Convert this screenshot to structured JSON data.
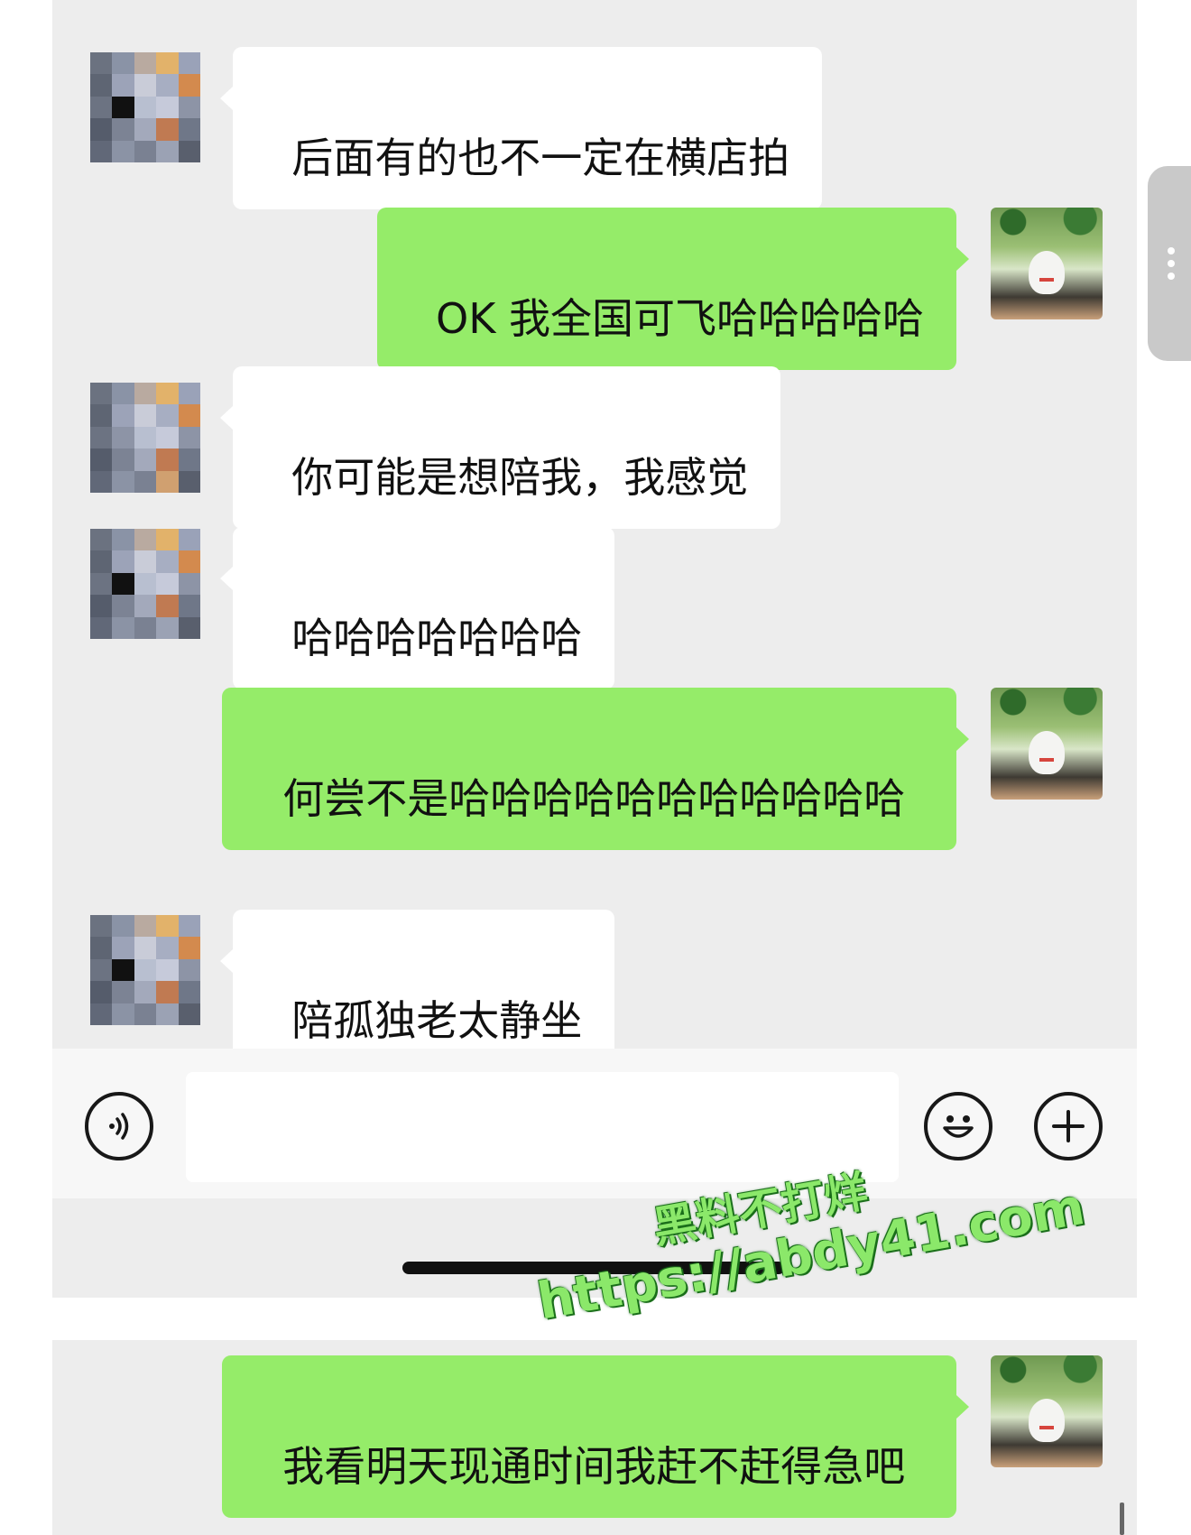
{
  "chat": {
    "messages": [
      {
        "side": "received",
        "text": "后面有的也不一定在横店拍"
      },
      {
        "side": "sent",
        "text": "OK 我全国可飞哈哈哈哈哈"
      },
      {
        "side": "received",
        "text": "你可能是想陪我，我感觉"
      },
      {
        "side": "received",
        "text": "哈哈哈哈哈哈哈"
      },
      {
        "side": "sent",
        "text": "何尝不是哈哈哈哈哈哈哈哈哈哈哈"
      },
      {
        "side": "received",
        "text": "陪孤独老太静坐"
      },
      {
        "side": "sent",
        "text": "我看明天现通时间我赶不赶得急吧"
      }
    ]
  },
  "input_bar": {
    "voice_icon": "voice-icon",
    "emoji_icon": "emoji-icon",
    "plus_icon": "plus-icon",
    "text_value": ""
  },
  "watermark": {
    "line1": "黑料不打烊",
    "line2": "https://abdy41.com"
  },
  "colors": {
    "sent_bubble": "#95ec69",
    "received_bubble": "#ffffff",
    "chat_background": "#ededed"
  }
}
